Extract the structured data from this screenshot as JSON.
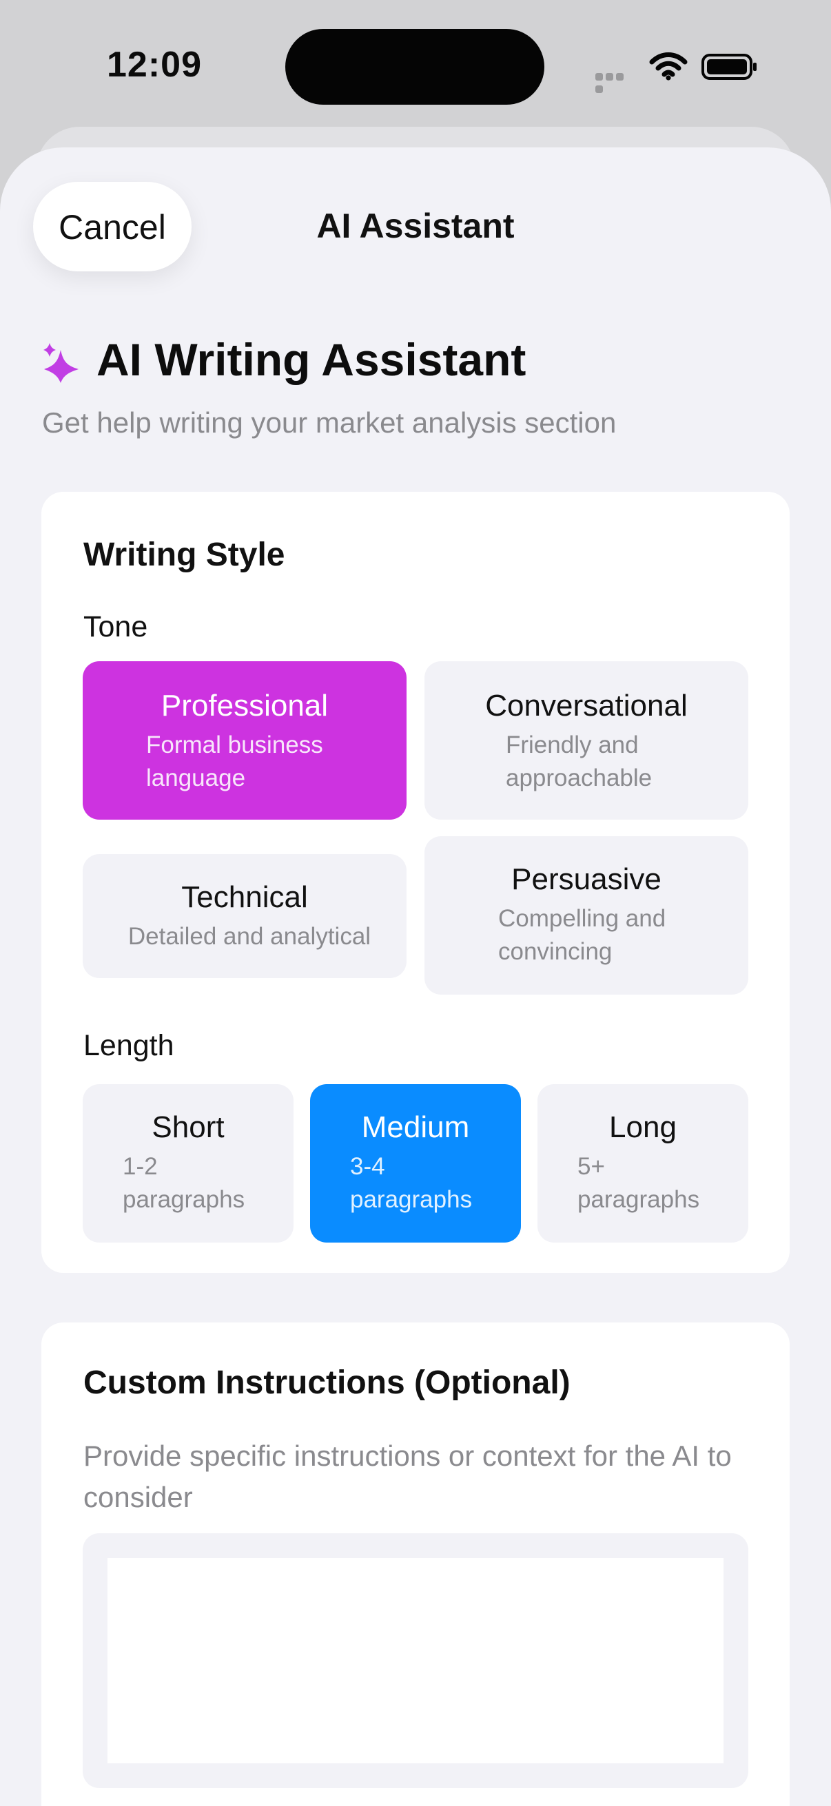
{
  "status_bar": {
    "time": "12:09"
  },
  "nav": {
    "cancel_label": "Cancel",
    "title": "AI Assistant"
  },
  "header": {
    "icon": "sparkles-icon",
    "title": "AI Writing Assistant",
    "subtitle": "Get help writing your market analysis section"
  },
  "writing_style": {
    "title": "Writing Style",
    "tone_label": "Tone",
    "tones": [
      {
        "title": "Professional",
        "description": "Formal business language",
        "selected": true
      },
      {
        "title": "Conversational",
        "description": "Friendly and approachable",
        "selected": false
      },
      {
        "title": "Technical",
        "description": "Detailed and analytical",
        "selected": false
      },
      {
        "title": "Persuasive",
        "description": "Compelling and convincing",
        "selected": false
      }
    ],
    "length_label": "Length",
    "lengths": [
      {
        "title": "Short",
        "description": "1-2 paragraphs",
        "selected": false
      },
      {
        "title": "Medium",
        "description": "3-4 paragraphs",
        "selected": true
      },
      {
        "title": "Long",
        "description": "5+ paragraphs",
        "selected": false
      }
    ]
  },
  "custom_instructions": {
    "title": "Custom Instructions (Optional)",
    "subtitle": "Provide specific instructions or context for the AI to consider",
    "value": "",
    "placeholder": ""
  },
  "colors": {
    "selected_tone": "#cd33e0",
    "selected_length": "#0a8cff",
    "accent_icon": "#c13ee4"
  }
}
